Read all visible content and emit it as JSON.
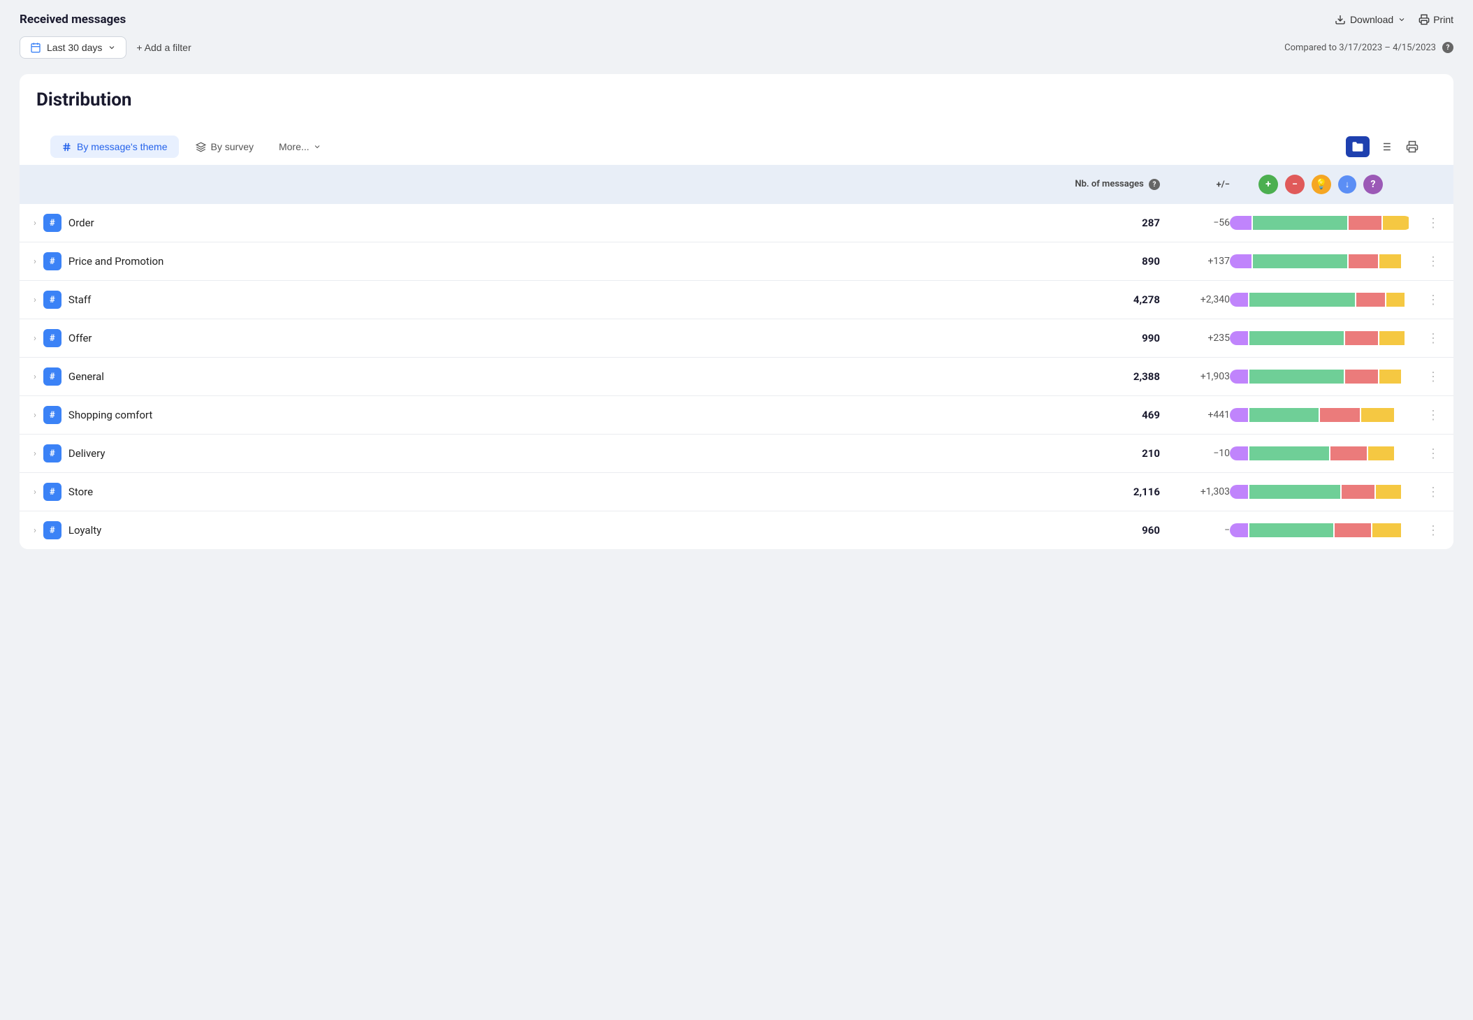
{
  "header": {
    "title": "Received messages",
    "download_label": "Download",
    "print_label": "Print"
  },
  "filters": {
    "date_label": "Last 30 days",
    "add_filter_label": "+ Add a filter",
    "compared_label": "Compared to 3/17/2023 – 4/15/2023"
  },
  "distribution": {
    "section_title": "Distribution",
    "tabs": [
      {
        "label": "By message's theme",
        "active": true
      },
      {
        "label": "By survey",
        "active": false
      },
      {
        "label": "More...",
        "active": false
      }
    ],
    "table_header": {
      "col_label": "",
      "col_messages": "Nb. of messages",
      "col_diff": "+/−",
      "col_sentiment": [
        "positive",
        "negative",
        "idea",
        "download",
        "question"
      ]
    },
    "rows": [
      {
        "name": "Order",
        "count": "287",
        "diff": "−56",
        "diff_type": "negative",
        "bars": [
          12,
          52,
          18,
          14
        ]
      },
      {
        "name": "Price and Promotion",
        "count": "890",
        "diff": "+137",
        "diff_type": "positive",
        "bars": [
          12,
          52,
          16,
          12
        ]
      },
      {
        "name": "Staff",
        "count": "4,278",
        "diff": "+2,340",
        "diff_type": "positive",
        "bars": [
          10,
          58,
          16,
          10
        ]
      },
      {
        "name": "Offer",
        "count": "990",
        "diff": "+235",
        "diff_type": "positive",
        "bars": [
          10,
          52,
          18,
          14
        ]
      },
      {
        "name": "General",
        "count": "2,388",
        "diff": "+1,903",
        "diff_type": "positive",
        "bars": [
          10,
          52,
          18,
          12
        ]
      },
      {
        "name": "Shopping comfort",
        "count": "469",
        "diff": "+441",
        "diff_type": "positive",
        "bars": [
          10,
          38,
          22,
          18
        ]
      },
      {
        "name": "Delivery",
        "count": "210",
        "diff": "−10",
        "diff_type": "negative",
        "bars": [
          10,
          44,
          20,
          14
        ]
      },
      {
        "name": "Store",
        "count": "2,116",
        "diff": "+1,303",
        "diff_type": "positive",
        "bars": [
          10,
          50,
          18,
          14
        ]
      },
      {
        "name": "Loyalty",
        "count": "960",
        "diff": "−",
        "diff_type": "neutral",
        "bars": [
          10,
          46,
          20,
          16
        ]
      }
    ]
  }
}
